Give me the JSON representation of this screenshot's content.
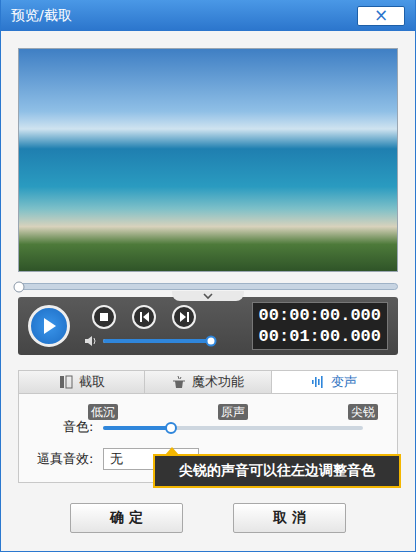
{
  "window": {
    "title": "预览/截取",
    "close": "×"
  },
  "player": {
    "progress": 0,
    "times": [
      "00:00:00.000",
      "00:01:00.000"
    ],
    "volume": 1.0
  },
  "tabs": [
    {
      "label": "截取",
      "selected": false
    },
    {
      "label": "魔术功能",
      "selected": false
    },
    {
      "label": "变声",
      "selected": true
    }
  ],
  "voice": {
    "label": "音色:",
    "marks": [
      "低沉",
      "原声",
      "尖锐"
    ],
    "level": 0.26
  },
  "effect": {
    "label": "逼真音效:",
    "value": "无"
  },
  "tooltip": "尖锐的声音可以往左边调整音色",
  "buttons": [
    "确 定",
    "取 消"
  ]
}
